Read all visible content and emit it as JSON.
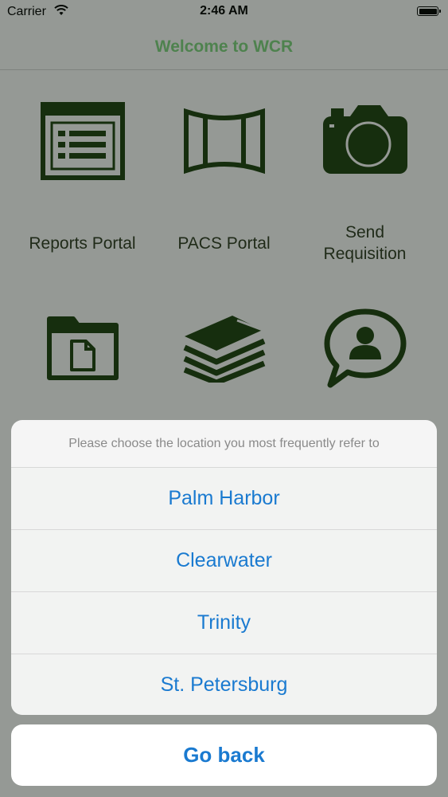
{
  "status_bar": {
    "carrier": "Carrier",
    "time": "2:46 AM"
  },
  "nav": {
    "title": "Welcome to WCR"
  },
  "tiles": [
    {
      "label": "Reports Portal",
      "icon": "report-grid-icon"
    },
    {
      "label": "PACS Portal",
      "icon": "panorama-film-icon"
    },
    {
      "label_line1": "Send",
      "label_line2": "Requisition",
      "icon": "camera-icon"
    },
    {
      "icon": "folder-document-icon"
    },
    {
      "icon": "stacked-papers-icon"
    },
    {
      "icon": "chat-person-icon"
    }
  ],
  "action_sheet": {
    "message": "Please choose the location you most frequently refer to",
    "options": [
      "Palm Harbor",
      "Clearwater",
      "Trinity",
      "St. Petersburg"
    ],
    "cancel": "Go back"
  },
  "colors": {
    "icon_green": "#1d3f0e",
    "title_green": "#7dcf7d",
    "action_blue": "#1a7ad0"
  }
}
